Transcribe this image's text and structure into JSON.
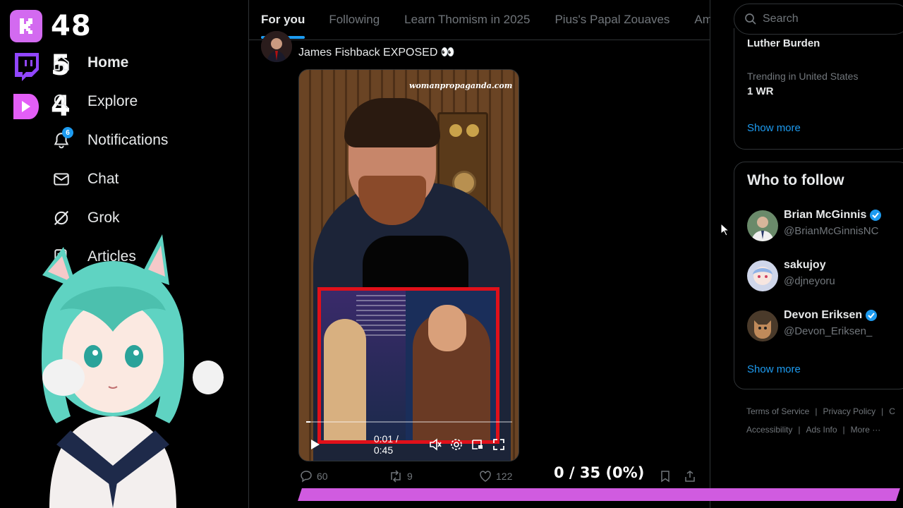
{
  "overlay": {
    "stats": [
      {
        "platform": "kick",
        "count": "48",
        "color": "#d36af0"
      },
      {
        "platform": "twitch",
        "count": "5",
        "color": "#9146ff"
      },
      {
        "platform": "kick-alt",
        "count": "4",
        "color": "#e35ef7"
      }
    ],
    "goal_text": "0 / 35 (0%)",
    "goal_progress_fraction": 0.0
  },
  "nav": {
    "items": [
      {
        "label": "Home",
        "icon": "home-icon"
      },
      {
        "label": "Explore",
        "icon": "search-icon"
      },
      {
        "label": "Notifications",
        "icon": "bell-icon",
        "badge": "6"
      },
      {
        "label": "Chat",
        "icon": "mail-icon"
      },
      {
        "label": "Grok",
        "icon": "grok-icon"
      },
      {
        "label": "Articles",
        "icon": "article-icon"
      }
    ]
  },
  "tabs": [
    "For you",
    "Following",
    "Learn Thomism in 2025",
    "Pius's Papal Zouaves",
    "Am"
  ],
  "tweet": {
    "text": "James Fishback EXPOSED 👀",
    "video": {
      "watermark": "womanpropaganda.com",
      "time": "0:01 / 0:45",
      "progress_fraction": 0.02
    },
    "actions": {
      "replies": "60",
      "reposts": "9",
      "likes": "122"
    }
  },
  "search": {
    "placeholder": "Search"
  },
  "trends": {
    "item1_title": "Luther Burden",
    "item2_context": "Trending in United States",
    "item2_title": "1 WR",
    "show_more": "Show more"
  },
  "who_to_follow": {
    "title": "Who to follow",
    "accounts": [
      {
        "name": "Brian McGinnis",
        "handle": "@BrianMcGinnisNC",
        "verified": true
      },
      {
        "name": "sakujoy",
        "handle": "@djneyoru",
        "verified": false
      },
      {
        "name": "Devon Eriksen",
        "handle": "@Devon_Eriksen_",
        "verified": true
      }
    ],
    "show_more": "Show more"
  },
  "footer": {
    "links_row1": [
      "Terms of Service",
      "Privacy Policy",
      "C"
    ],
    "links_row2": [
      "Accessibility",
      "Ads Info",
      "More ···"
    ]
  },
  "colors": {
    "accent": "#1d9bf0",
    "goal_bar": "#d05be0",
    "background": "#000000"
  }
}
